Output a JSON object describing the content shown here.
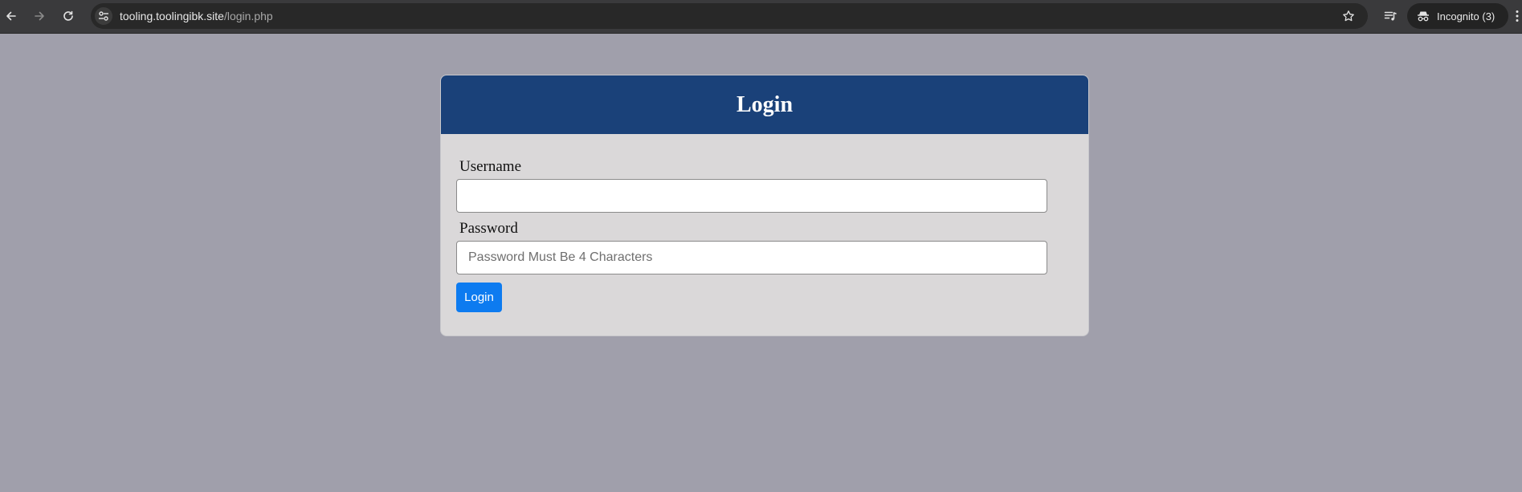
{
  "browser": {
    "url_host": "tooling.toolingibk.site",
    "url_path": "/login.php",
    "incognito_label": "Incognito (3)"
  },
  "login_form": {
    "title": "Login",
    "username_label": "Username",
    "username_value": "",
    "password_label": "Password",
    "password_placeholder": "Password Must Be 4 Characters",
    "submit_label": "Login"
  },
  "colors": {
    "page_background": "#a09fab",
    "header_background": "#1a4179",
    "card_background": "#dad8d9",
    "button_background": "#0d7bf0"
  }
}
